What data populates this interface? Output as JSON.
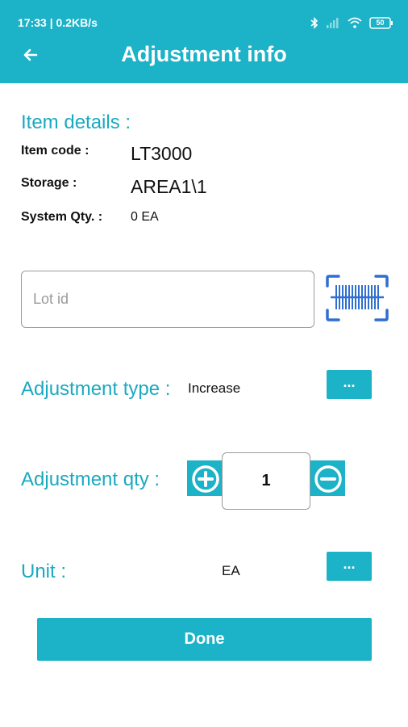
{
  "status_bar": {
    "time_speed": "17:33 | 0.2KB/s",
    "battery": "50",
    "icons": [
      "bluetooth-icon",
      "signal-icon",
      "wifi-icon",
      "battery-icon"
    ]
  },
  "header": {
    "title": "Adjustment info",
    "back_icon": "arrow-left-icon"
  },
  "item_details": {
    "heading": "Item details :",
    "item_code_label": "Item code :",
    "item_code_value": "LT3000",
    "storage_label": "Storage :",
    "storage_value": "AREA1\\1",
    "system_qty_label": "System Qty. :",
    "system_qty_value": "0 EA"
  },
  "lot": {
    "placeholder": "Lot id",
    "value": "",
    "scan_icon": "barcode-scan-icon"
  },
  "adjustment_type": {
    "label": "Adjustment type :",
    "value": "Increase",
    "button_label": "..."
  },
  "adjustment_qty": {
    "label": "Adjustment qty :",
    "value": "1",
    "increment_icon": "plus-circle-icon",
    "decrement_icon": "minus-circle-icon"
  },
  "unit": {
    "label": "Unit :",
    "value": "EA",
    "button_label": "..."
  },
  "actions": {
    "done_label": "Done"
  },
  "colors": {
    "accent": "#1cb2c7",
    "heading_text": "#1aa9c0",
    "scan_icon": "#2f6fd0"
  }
}
